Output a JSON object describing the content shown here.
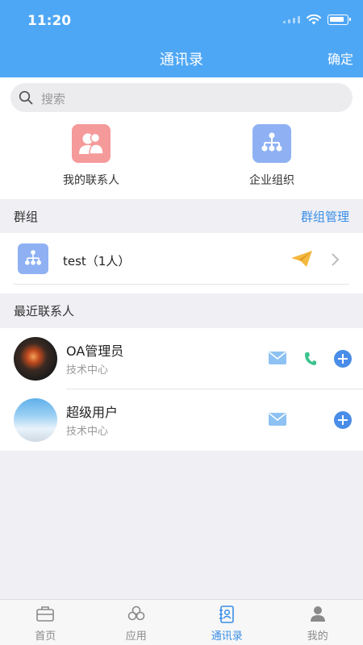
{
  "status_bar": {
    "time": "11:20"
  },
  "header": {
    "title": "通讯录",
    "confirm_label": "确定"
  },
  "search": {
    "placeholder": "搜索"
  },
  "shortcuts": [
    {
      "label": "我的联系人",
      "icon": "people-icon",
      "color": "#f59a9a"
    },
    {
      "label": "企业组织",
      "icon": "org-chart-icon",
      "color": "#8fb1f3"
    }
  ],
  "groups": {
    "title": "群组",
    "manage_label": "群组管理",
    "items": [
      {
        "name": "test（1人）",
        "icon": "org-chart-icon"
      }
    ]
  },
  "recent": {
    "title": "最近联系人",
    "items": [
      {
        "name": "OA管理员",
        "dept": "技术中心",
        "actions": [
          "mail-icon",
          "phone-icon",
          "add-icon"
        ]
      },
      {
        "name": "超级用户",
        "dept": "技术中心",
        "actions": [
          "mail-icon",
          "add-icon"
        ]
      }
    ]
  },
  "tabs": [
    {
      "label": "首页",
      "icon": "briefcase-icon",
      "active": false
    },
    {
      "label": "应用",
      "icon": "cloud-apps-icon",
      "active": false
    },
    {
      "label": "通讯录",
      "icon": "contacts-book-icon",
      "active": true
    },
    {
      "label": "我的",
      "icon": "person-icon",
      "active": false
    }
  ],
  "colors": {
    "primary": "#4ea7f5",
    "accent": "#3a8ee6",
    "send": "#f5b942",
    "phone": "#3cc38e"
  }
}
